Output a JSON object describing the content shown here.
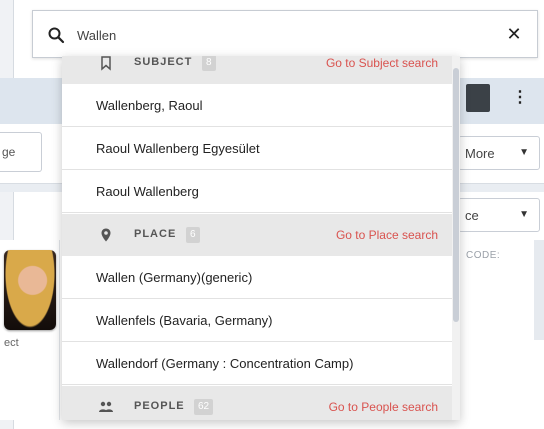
{
  "search": {
    "value": "Wallen",
    "clear_icon": "close-icon",
    "search_icon": "search-icon"
  },
  "background": {
    "left_select_text": "ge",
    "more_select": "More",
    "sort_select": "ce",
    "card_code_label": "CODE:",
    "card_caption": "ect"
  },
  "dropdown": {
    "groups": [
      {
        "icon": "bookmark-icon",
        "label": "SUBJECT",
        "count": "8",
        "link": "Go to Subject search",
        "items": [
          "Wallenberg, Raoul",
          "Raoul Wallenberg Egyesület",
          "Raoul Wallenberg"
        ]
      },
      {
        "icon": "map-marker-icon",
        "label": "PLACE",
        "count": "6",
        "link": "Go to Place search",
        "items": [
          "Wallen (Germany)(generic)",
          "Wallenfels (Bavaria, Germany)",
          "Wallendorf (Germany : Concentration Camp)"
        ]
      },
      {
        "icon": "people-icon",
        "label": "PEOPLE",
        "count": "62",
        "link": "Go to People search",
        "items": []
      }
    ]
  },
  "colors": {
    "link_red": "#d9534f",
    "group_header_bg": "#e8e8e8",
    "count_badge_bg": "#d2d2d2",
    "page_band_blue": "#dde5ee"
  }
}
